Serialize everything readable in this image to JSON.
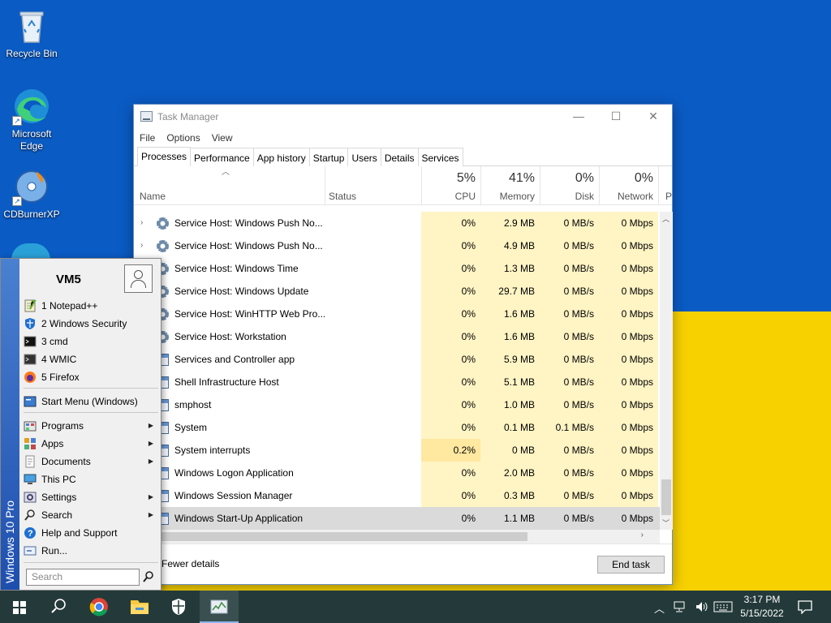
{
  "desktop": {
    "icons": [
      {
        "label_l1": "Recycle Bin",
        "label_l2": ""
      },
      {
        "label_l1": "Microsoft",
        "label_l2": "Edge"
      },
      {
        "label_l1": "CDBurnerXP",
        "label_l2": ""
      }
    ]
  },
  "task_manager": {
    "title": "Task Manager",
    "menu": [
      "File",
      "Options",
      "View"
    ],
    "tabs": [
      "Processes",
      "Performance",
      "App history",
      "Startup",
      "Users",
      "Details",
      "Services"
    ],
    "active_tab": "Processes",
    "headers": {
      "name": "Name",
      "status": "Status",
      "cpu_pct": "5%",
      "cpu": "CPU",
      "mem_pct": "41%",
      "mem": "Memory",
      "disk_pct": "0%",
      "disk": "Disk",
      "net_pct": "0%",
      "net": "Network",
      "overflow": "P"
    },
    "rows": [
      {
        "name": "Service Host: Windows Push No...",
        "cpu": "0%",
        "mem": "2.9 MB",
        "disk": "0 MB/s",
        "net": "0 Mbps",
        "expand": true,
        "icon": "gear-icon"
      },
      {
        "name": "Service Host: Windows Push No...",
        "cpu": "0%",
        "mem": "4.9 MB",
        "disk": "0 MB/s",
        "net": "0 Mbps",
        "expand": true,
        "icon": "gear-icon"
      },
      {
        "name": "Service Host: Windows Time",
        "cpu": "0%",
        "mem": "1.3 MB",
        "disk": "0 MB/s",
        "net": "0 Mbps",
        "expand": true,
        "icon": "gear-icon"
      },
      {
        "name": "Service Host: Windows Update",
        "cpu": "0%",
        "mem": "29.7 MB",
        "disk": "0 MB/s",
        "net": "0 Mbps",
        "expand": true,
        "icon": "gear-icon"
      },
      {
        "name": "Service Host: WinHTTP Web Pro...",
        "cpu": "0%",
        "mem": "1.6 MB",
        "disk": "0 MB/s",
        "net": "0 Mbps",
        "expand": true,
        "icon": "gear-icon"
      },
      {
        "name": "Service Host: Workstation",
        "cpu": "0%",
        "mem": "1.6 MB",
        "disk": "0 MB/s",
        "net": "0 Mbps",
        "expand": true,
        "icon": "gear-icon"
      },
      {
        "name": "Services and Controller app",
        "cpu": "0%",
        "mem": "5.9 MB",
        "disk": "0 MB/s",
        "net": "0 Mbps",
        "expand": false,
        "icon": "window-icon"
      },
      {
        "name": "Shell Infrastructure Host",
        "cpu": "0%",
        "mem": "5.1 MB",
        "disk": "0 MB/s",
        "net": "0 Mbps",
        "expand": false,
        "icon": "window-icon"
      },
      {
        "name": "smphost",
        "cpu": "0%",
        "mem": "1.0 MB",
        "disk": "0 MB/s",
        "net": "0 Mbps",
        "expand": false,
        "icon": "window-icon"
      },
      {
        "name": "System",
        "cpu": "0%",
        "mem": "0.1 MB",
        "disk": "0.1 MB/s",
        "net": "0 Mbps",
        "expand": false,
        "icon": "window-icon"
      },
      {
        "name": "System interrupts",
        "cpu": "0.2%",
        "mem": "0 MB",
        "disk": "0 MB/s",
        "net": "0 Mbps",
        "expand": false,
        "icon": "window-icon"
      },
      {
        "name": "Windows Logon Application",
        "cpu": "0%",
        "mem": "2.0 MB",
        "disk": "0 MB/s",
        "net": "0 Mbps",
        "expand": false,
        "icon": "window-icon"
      },
      {
        "name": "Windows Session Manager",
        "cpu": "0%",
        "mem": "0.3 MB",
        "disk": "0 MB/s",
        "net": "0 Mbps",
        "expand": false,
        "icon": "window-icon"
      },
      {
        "name": "Windows Start-Up Application",
        "cpu": "0%",
        "mem": "1.1 MB",
        "disk": "0 MB/s",
        "net": "0 Mbps",
        "expand": false,
        "icon": "window-icon",
        "selected": true
      }
    ],
    "fewer_details": "Fewer details",
    "end_task": "End task"
  },
  "start_menu": {
    "side_label": "Windows 10 Pro",
    "user": "VM5",
    "pinned": [
      "1 Notepad++",
      "2 Windows Security",
      "3 cmd",
      "4 WMIC",
      "5 Firefox"
    ],
    "classic": "Start Menu (Windows)",
    "items": [
      "Programs",
      "Apps",
      "Documents",
      "This PC",
      "Settings",
      "Search",
      "Help and Support",
      "Run..."
    ],
    "search_placeholder": "Search"
  },
  "taskbar": {
    "time": "3:17 PM",
    "date": "5/15/2022"
  },
  "colors": {
    "wallpaper_top": "#0a5bc4",
    "wallpaper_bottom": "#f8d100",
    "taskbar": "#243a3a",
    "heat_cell": "#fff4c4"
  }
}
